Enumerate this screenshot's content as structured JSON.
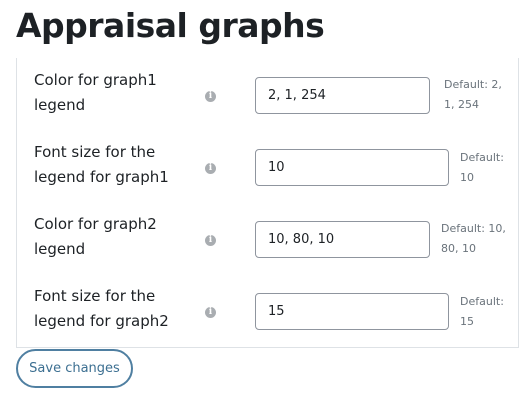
{
  "page": {
    "title": "Appraisal graphs"
  },
  "settings": [
    {
      "label_line1": "Color for graph1",
      "label_line2": "legend",
      "value": "2, 1, 254",
      "default_line1": "Default: 2,",
      "default_line2": "1, 254"
    },
    {
      "label_line1": "Font size for the",
      "label_line2": "legend for graph1",
      "value": "10",
      "default_line1": "Default:",
      "default_line2": "10"
    },
    {
      "label_line1": "Color for graph2",
      "label_line2": "legend",
      "value": "10, 80, 10",
      "default_line1": "Default: 10,",
      "default_line2": "80, 10"
    },
    {
      "label_line1": "Font size for the",
      "label_line2": "legend for graph2",
      "value": "15",
      "default_line1": "Default:",
      "default_line2": "15"
    }
  ],
  "info_icon_glyph": "i",
  "actions": {
    "save_label": "Save changes"
  }
}
